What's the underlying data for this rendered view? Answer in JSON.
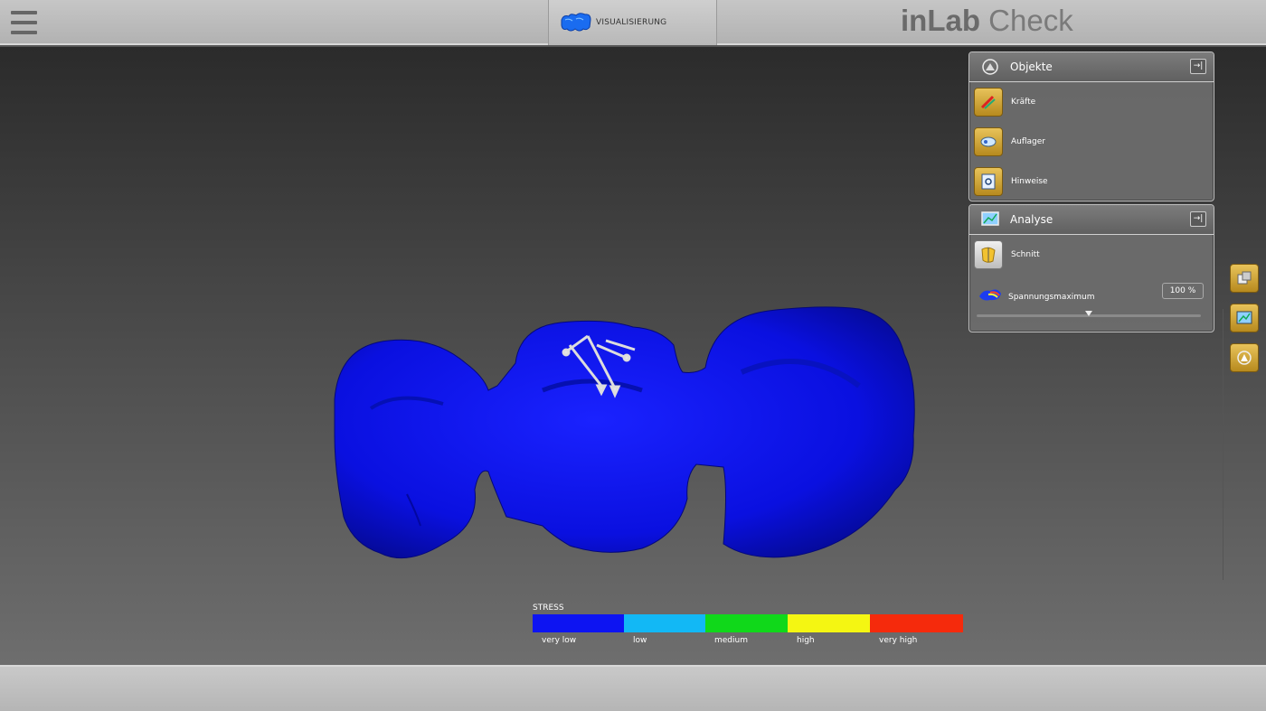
{
  "header": {
    "tab_label": "VISUALISIERUNG",
    "brand_bold": "inLab",
    "brand_light": "Check"
  },
  "panels": {
    "objekte": {
      "title": "Objekte",
      "items": [
        {
          "label": "Kräfte",
          "icon": "forces-icon"
        },
        {
          "label": "Auflager",
          "icon": "supports-icon"
        },
        {
          "label": "Hinweise",
          "icon": "notes-icon"
        }
      ]
    },
    "analyse": {
      "title": "Analyse",
      "items": [
        {
          "label": "Schnitt",
          "icon": "cut-icon"
        },
        {
          "label": "Spannungsmaximum",
          "icon": "stress-map-icon",
          "value": "100 %"
        }
      ],
      "slider_level": 0.5
    }
  },
  "side_buttons": [
    "cube-view-icon",
    "analysis-view-icon",
    "objects-view-icon"
  ],
  "legend": {
    "title": "STRESS",
    "levels": [
      {
        "label": "very low",
        "color": "#0d14f2"
      },
      {
        "label": "low",
        "color": "#12b8f5"
      },
      {
        "label": "medium",
        "color": "#10d81a"
      },
      {
        "label": "high",
        "color": "#f4f612"
      },
      {
        "label": "very high",
        "color": "#f52a0c"
      }
    ]
  },
  "model": {
    "color": "#0a0fe6"
  }
}
